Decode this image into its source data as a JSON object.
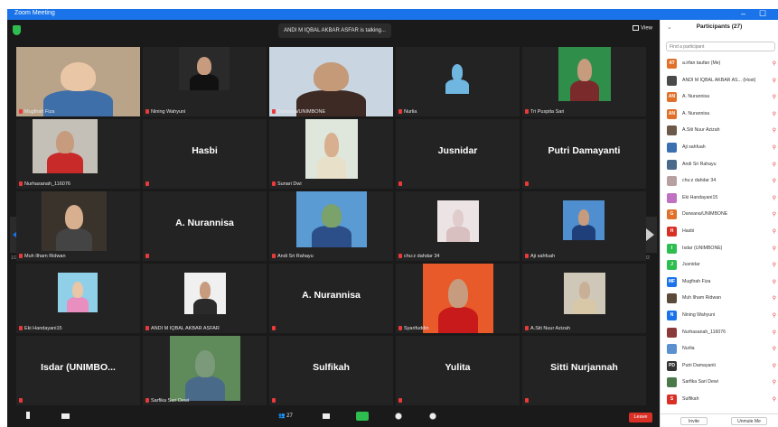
{
  "window": {
    "title": "Zoom Meeting",
    "minimize": "–",
    "maximize": "☐"
  },
  "topbar": {
    "speaking": "ANDI M IQBAL AKBAR ASFAR is talking...",
    "view": "View"
  },
  "tiles": [
    {
      "label": "Mugfirah Fiza",
      "bigname": ""
    },
    {
      "label": "Nining Wahyuni",
      "bigname": ""
    },
    {
      "label": "Darwana/UNIMBONE",
      "bigname": ""
    },
    {
      "label": "Nurlia",
      "bigname": ""
    },
    {
      "label": "Tri Puspita Sari",
      "bigname": ""
    },
    {
      "label": "Nurhasanah_116076",
      "bigname": ""
    },
    {
      "label": "",
      "bigname": "Hasbi"
    },
    {
      "label": "Sunari Dwi",
      "bigname": ""
    },
    {
      "label": "",
      "bigname": "Jusnidar"
    },
    {
      "label": "",
      "bigname": "Putri Damayanti"
    },
    {
      "label": "Muh Ilham Ridwan",
      "bigname": ""
    },
    {
      "label": "",
      "bigname": "A. Nurannisa"
    },
    {
      "label": "Andi Sri Rahayu",
      "bigname": ""
    },
    {
      "label": "chu:z dahdar 34",
      "bigname": ""
    },
    {
      "label": "Aji sahfuah",
      "bigname": ""
    },
    {
      "label": "Eki Handayani15",
      "bigname": ""
    },
    {
      "label": "ANDI M IQBAL AKBAR ASFAR",
      "bigname": ""
    },
    {
      "label": "",
      "bigname": "A. Nurannisa"
    },
    {
      "label": "Syarifuddin",
      "bigname": ""
    },
    {
      "label": "A.Siti Nuur Azizah",
      "bigname": ""
    },
    {
      "label": "",
      "bigname": "Isdar (UNIMBO..."
    },
    {
      "label": "Sarfika Sari Dewi",
      "bigname": ""
    },
    {
      "label": "",
      "bigname": "Sulfikah"
    },
    {
      "label": "",
      "bigname": "Yulita"
    },
    {
      "label": "",
      "bigname": "Sitti Nurjannah"
    }
  ],
  "nav": {
    "left_page": "1/2",
    "right_page": "1/2"
  },
  "toolbar": {
    "participants_count": "27",
    "leave": "Leave"
  },
  "participants": {
    "title": "Participants (27)",
    "search_placeholder": "Find a participant",
    "items": [
      {
        "initials": "AT",
        "name": "a.irfan taufan (Me)",
        "color": "#e0702a"
      },
      {
        "initials": "",
        "name": "ANDI M IQBAL AKBAR AS... (Host)",
        "color": "#4a4a4a"
      },
      {
        "initials": "AN",
        "name": "A. Nurannisa",
        "color": "#e0702a"
      },
      {
        "initials": "AN",
        "name": "A. Nurannisa",
        "color": "#e0702a"
      },
      {
        "initials": "",
        "name": "A.Siti Nuur Azizah",
        "color": "#6b5a4a"
      },
      {
        "initials": "",
        "name": "Aji sahfuah",
        "color": "#3a6fb0"
      },
      {
        "initials": "",
        "name": "Andi Sri Rahayu",
        "color": "#4a6a8a"
      },
      {
        "initials": "",
        "name": "chu:z dahdar 34",
        "color": "#b7a0a0"
      },
      {
        "initials": "",
        "name": "Eki Handayani15",
        "color": "#c070c0"
      },
      {
        "initials": "G",
        "name": "Darwana/UNIMBONE",
        "color": "#e0702a"
      },
      {
        "initials": "H",
        "name": "Hasbi",
        "color": "#d93025"
      },
      {
        "initials": "I",
        "name": "Isdar (UNIMBONE)",
        "color": "#2dbe4f"
      },
      {
        "initials": "J",
        "name": "Jusnidar",
        "color": "#2dbe4f"
      },
      {
        "initials": "MF",
        "name": "Mugfirah Fiza",
        "color": "#1a73e8"
      },
      {
        "initials": "",
        "name": "Muh Ilham Ridwan",
        "color": "#5a4a3a"
      },
      {
        "initials": "N",
        "name": "Nining Wahyuni",
        "color": "#1a73e8"
      },
      {
        "initials": "",
        "name": "Nurhasanah_116076",
        "color": "#8a3a3a"
      },
      {
        "initials": "",
        "name": "Nurlia",
        "color": "#5a8fd0"
      },
      {
        "initials": "PD",
        "name": "Putri Damayanti",
        "color": "#333333"
      },
      {
        "initials": "",
        "name": "Sarfika Sari Dewi",
        "color": "#4a7a4a"
      },
      {
        "initials": "S",
        "name": "Sulfikah",
        "color": "#d93025"
      }
    ],
    "invite": "Invite",
    "unmute": "Unmute Me"
  }
}
